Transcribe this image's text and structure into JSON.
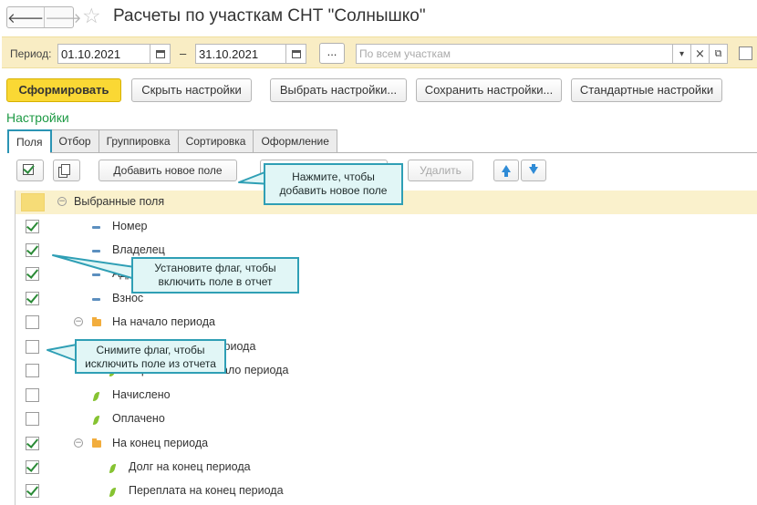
{
  "window": {
    "title": "Расчеты по участкам СНТ \"Солнышко\"",
    "back_glyph": "🡐",
    "forward_glyph": "🡒",
    "favorite_glyph": "☆"
  },
  "period": {
    "label": "Период:",
    "start_date": "01.10.2021",
    "end_date": "31.10.2021",
    "separator": "–",
    "more_button": "...",
    "plot_placeholder": "По всем участкам",
    "dropdown_glyph": "▾",
    "clear_glyph": "×",
    "open_glyph": "⧉"
  },
  "toolbar": {
    "generate": "Сформировать",
    "hide_settings": "Скрыть настройки",
    "choose_settings": "Выбрать настройки...",
    "save_settings": "Сохранить настройки...",
    "default_settings": "Стандартные настройки"
  },
  "settings": {
    "title": "Настройки",
    "tabs": [
      "Поля",
      "Отбор",
      "Группировка",
      "Сортировка",
      "Оформление"
    ]
  },
  "fields_toolbar": {
    "add_field": "Добавить новое поле",
    "delete": "Удалить"
  },
  "tree": {
    "root": "Выбранные поля",
    "rows": [
      {
        "label": "Номер",
        "checked": true
      },
      {
        "label": "Владелец",
        "checked": true
      },
      {
        "label": "Адрес",
        "checked": true
      },
      {
        "label": "Взнос",
        "checked": true
      },
      {
        "label": "На начало периода",
        "checked": false
      },
      {
        "label": "Долг на начало периода",
        "checked": false
      },
      {
        "label": "Переплата на начало периода",
        "checked": false
      },
      {
        "label": "Начислено",
        "checked": false
      },
      {
        "label": "Оплачено",
        "checked": false
      },
      {
        "label": "На конец периода",
        "checked": true
      },
      {
        "label": "Долг на конец периода",
        "checked": true
      },
      {
        "label": "Переплата на конец периода",
        "checked": true
      }
    ]
  },
  "callouts": {
    "add_field_line1": "Нажмите, чтобы",
    "add_field_line2": "добавить новое поле",
    "check_line1": "Установите флаг, чтобы",
    "check_line2": "включить поле в отчет",
    "uncheck_line1": "Снимите флаг, чтобы",
    "uncheck_line2": "исключить поле из отчета"
  },
  "colors": {
    "accent_yellow": "#fad834",
    "settings_green": "#1d9a44",
    "callout_border": "#2f9fb5",
    "callout_fill": "#e1f6f6"
  }
}
